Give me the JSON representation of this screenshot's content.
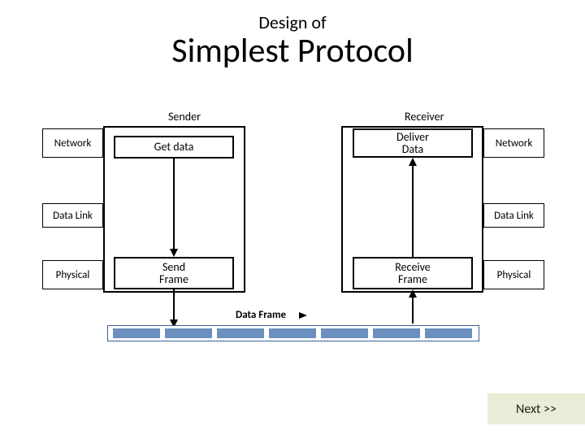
{
  "title": {
    "small": "Design of",
    "large": "Simplest Protocol"
  },
  "headers": {
    "sender": "Sender",
    "receiver": "Receiver"
  },
  "layers": {
    "network": "Network",
    "datalink": "Data Link",
    "physical": "Physical"
  },
  "sender_box": {
    "get_data": "Get data",
    "send_frame": "Send\nFrame"
  },
  "receiver_box": {
    "deliver_data": "Deliver\nData",
    "receive_frame": "Receive\nFrame"
  },
  "frame_label": "Data Frame",
  "nav": {
    "next": "Next >>"
  },
  "colors": {
    "channel_fill": "#6b8fbf",
    "channel_border": "#3a5f8f",
    "next_bg": "#e9ecd6"
  }
}
